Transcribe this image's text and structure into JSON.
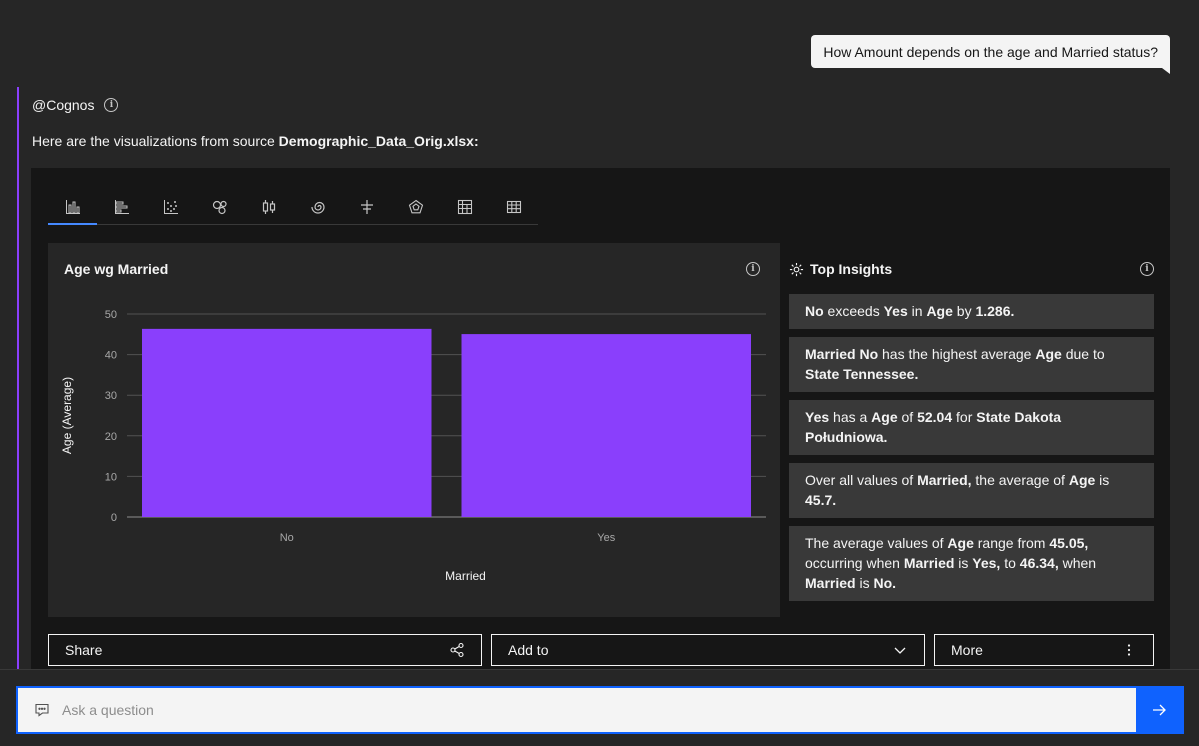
{
  "user_message": "How Amount depends on the age and Married status?",
  "assistant": {
    "name": "@Cognos",
    "intro_prefix": "Here are the visualizations from source ",
    "intro_source": "Demographic_Data_Orig.xlsx:"
  },
  "tabs": [
    {
      "icon": "column-chart-icon"
    },
    {
      "icon": "bar-chart-icon"
    },
    {
      "icon": "scatter-dots-icon"
    },
    {
      "icon": "bubble-chart-icon"
    },
    {
      "icon": "boxplot-icon"
    },
    {
      "icon": "spiral-chart-icon"
    },
    {
      "icon": "bullet-chart-icon"
    },
    {
      "icon": "radar-chart-icon"
    },
    {
      "icon": "crosstab-icon"
    },
    {
      "icon": "table-grid-icon"
    }
  ],
  "chart": {
    "title": "Age wg Married",
    "bar_color": "#8a3ffc"
  },
  "chart_data": {
    "type": "bar",
    "title": "Age wg Married",
    "categories": [
      "No",
      "Yes"
    ],
    "values": [
      46.34,
      45.05
    ],
    "xlabel": "Married",
    "ylabel": "Age (Average)",
    "ylim": [
      0,
      50
    ],
    "yticks": [
      0,
      10,
      20,
      30,
      40,
      50
    ],
    "grid": true
  },
  "insights": {
    "title": "Top Insights",
    "items": [
      [
        {
          "t": "No",
          "b": true
        },
        {
          "t": " exceeds "
        },
        {
          "t": "Yes",
          "b": true
        },
        {
          "t": " in "
        },
        {
          "t": "Age",
          "b": true
        },
        {
          "t": " by "
        },
        {
          "t": "1.286.",
          "b": true
        }
      ],
      [
        {
          "t": "Married No",
          "b": true
        },
        {
          "t": " has the highest average "
        },
        {
          "t": "Age",
          "b": true
        },
        {
          "t": " due to "
        },
        {
          "t": "State Tennessee.",
          "b": true
        }
      ],
      [
        {
          "t": "Yes",
          "b": true
        },
        {
          "t": " has a "
        },
        {
          "t": "Age",
          "b": true
        },
        {
          "t": " of "
        },
        {
          "t": "52.04",
          "b": true
        },
        {
          "t": " for "
        },
        {
          "t": "State Dakota Południowa.",
          "b": true
        }
      ],
      [
        {
          "t": "Over all values of "
        },
        {
          "t": "Married,",
          "b": true
        },
        {
          "t": " the average of "
        },
        {
          "t": "Age",
          "b": true
        },
        {
          "t": " is "
        },
        {
          "t": "45.7.",
          "b": true
        }
      ],
      [
        {
          "t": "The average values of "
        },
        {
          "t": "Age",
          "b": true
        },
        {
          "t": " range from "
        },
        {
          "t": "45.05,",
          "b": true
        },
        {
          "t": " occurring when "
        },
        {
          "t": "Married",
          "b": true
        },
        {
          "t": " is "
        },
        {
          "t": "Yes,",
          "b": true
        },
        {
          "t": " to "
        },
        {
          "t": "46.34,",
          "b": true
        },
        {
          "t": " when "
        },
        {
          "t": "Married",
          "b": true
        },
        {
          "t": " is "
        },
        {
          "t": "No.",
          "b": true
        }
      ]
    ]
  },
  "actions": {
    "share": "Share",
    "add_to": "Add to",
    "more": "More"
  },
  "ask": {
    "placeholder": "Ask a question"
  }
}
